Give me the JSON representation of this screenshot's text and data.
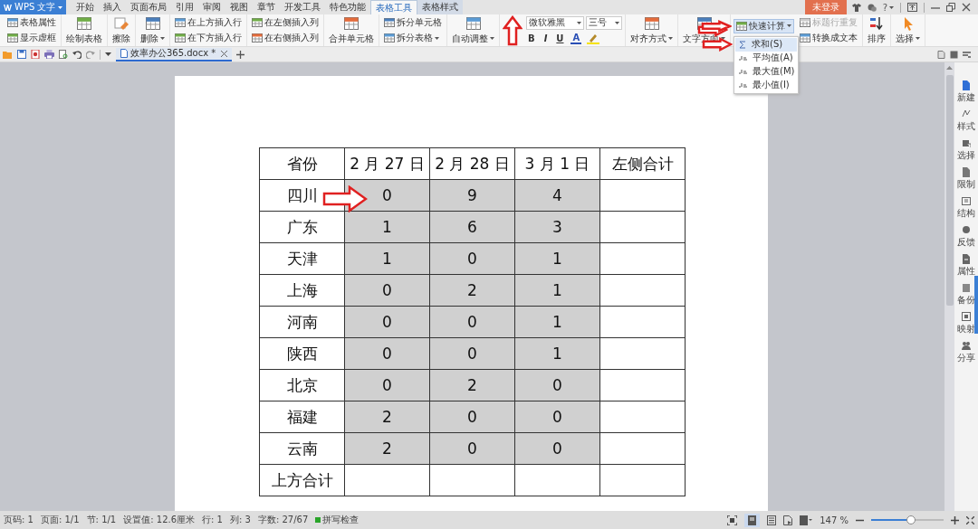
{
  "app_button": "WPS 文字",
  "menu_tabs": [
    {
      "label": "开始",
      "selected": false,
      "contextual": false
    },
    {
      "label": "插入",
      "selected": false,
      "contextual": false
    },
    {
      "label": "页面布局",
      "selected": false,
      "contextual": false
    },
    {
      "label": "引用",
      "selected": false,
      "contextual": false
    },
    {
      "label": "审阅",
      "selected": false,
      "contextual": false
    },
    {
      "label": "视图",
      "selected": false,
      "contextual": false
    },
    {
      "label": "章节",
      "selected": false,
      "contextual": false
    },
    {
      "label": "开发工具",
      "selected": false,
      "contextual": false
    },
    {
      "label": "特色功能",
      "selected": false,
      "contextual": false
    },
    {
      "label": "表格工具",
      "selected": true,
      "contextual": true
    },
    {
      "label": "表格样式",
      "selected": false,
      "contextual": true
    }
  ],
  "login_button": "未登录",
  "help_button": "?",
  "ribbon": [
    {
      "kind": "stack",
      "items": [
        {
          "label": "表格属性",
          "dropdown": false,
          "disabled": false
        },
        {
          "label": "显示虚框",
          "dropdown": false,
          "disabled": false
        }
      ]
    },
    {
      "kind": "large",
      "label": "绘制表格",
      "dropdown": false
    },
    {
      "kind": "large",
      "label": "擦除",
      "dropdown": false
    },
    {
      "kind": "large",
      "label": "删除",
      "dropdown": true
    },
    {
      "kind": "stack",
      "items": [
        {
          "label": "在上方插入行",
          "dropdown": false,
          "disabled": false
        },
        {
          "label": "在下方插入行",
          "dropdown": false,
          "disabled": false
        }
      ]
    },
    {
      "kind": "stack",
      "items": [
        {
          "label": "在左侧插入列",
          "dropdown": false,
          "disabled": false
        },
        {
          "label": "在右侧插入列",
          "dropdown": false,
          "disabled": false
        }
      ]
    },
    {
      "kind": "large",
      "label": "合并单元格",
      "dropdown": false
    },
    {
      "kind": "stack",
      "items": [
        {
          "label": "拆分单元格",
          "dropdown": false,
          "disabled": false
        },
        {
          "label": "拆分表格",
          "dropdown": true,
          "disabled": false
        }
      ]
    },
    {
      "kind": "large",
      "label": "自动调整",
      "dropdown": true
    },
    {
      "kind": "font",
      "font_name": "微软雅黑",
      "font_size": "三号",
      "buttons": [
        "B",
        "I",
        "U",
        "A"
      ]
    },
    {
      "kind": "large",
      "label": "对齐方式",
      "dropdown": true
    },
    {
      "kind": "large",
      "label": "文字方向",
      "dropdown": true
    },
    {
      "kind": "calc",
      "button": {
        "label": "快速计算",
        "dropdown": true,
        "expanded": true
      },
      "menu": [
        {
          "label": "求和(S)",
          "selected": true
        },
        {
          "label": "平均值(A)",
          "selected": false
        },
        {
          "label": "最大值(M)",
          "selected": false
        },
        {
          "label": "最小值(I)",
          "selected": false
        }
      ],
      "items": [
        {
          "label": "标题行重复",
          "dropdown": false,
          "disabled": true
        },
        {
          "label": "转换成文本",
          "dropdown": false,
          "disabled": false
        }
      ]
    },
    {
      "kind": "large",
      "label": "排序",
      "dropdown": false
    },
    {
      "kind": "large",
      "label": "选择",
      "dropdown": true
    }
  ],
  "document_tab": {
    "title": "效率办公365.docx *",
    "selected": true
  },
  "table": {
    "rows": [
      {
        "cells": [
          {
            "text": "省份",
            "selected": false
          },
          {
            "text": "2 月 27 日",
            "selected": false
          },
          {
            "text": "2 月 28 日",
            "selected": false
          },
          {
            "text": "3 月 1 日",
            "selected": false
          },
          {
            "text": "左侧合计",
            "selected": false
          }
        ]
      },
      {
        "cells": [
          {
            "text": "四川",
            "selected": false
          },
          {
            "text": "0",
            "selected": true
          },
          {
            "text": "9",
            "selected": true
          },
          {
            "text": "4",
            "selected": true
          },
          {
            "selected": false
          }
        ]
      },
      {
        "cells": [
          {
            "text": "广东",
            "selected": false
          },
          {
            "text": "1",
            "selected": true
          },
          {
            "text": "6",
            "selected": true
          },
          {
            "text": "3",
            "selected": true
          },
          {
            "selected": false
          }
        ]
      },
      {
        "cells": [
          {
            "text": "天津",
            "selected": false
          },
          {
            "text": "1",
            "selected": true
          },
          {
            "text": "0",
            "selected": true
          },
          {
            "text": "1",
            "selected": true
          },
          {
            "selected": false
          }
        ]
      },
      {
        "cells": [
          {
            "text": "上海",
            "selected": false
          },
          {
            "text": "0",
            "selected": true
          },
          {
            "text": "2",
            "selected": true
          },
          {
            "text": "1",
            "selected": true
          },
          {
            "selected": false
          }
        ]
      },
      {
        "cells": [
          {
            "text": "河南",
            "selected": false
          },
          {
            "text": "0",
            "selected": true
          },
          {
            "text": "0",
            "selected": true
          },
          {
            "text": "1",
            "selected": true
          },
          {
            "selected": false
          }
        ]
      },
      {
        "cells": [
          {
            "text": "陕西",
            "selected": false
          },
          {
            "text": "0",
            "selected": true
          },
          {
            "text": "0",
            "selected": true
          },
          {
            "text": "1",
            "selected": true
          },
          {
            "selected": false
          }
        ]
      },
      {
        "cells": [
          {
            "text": "北京",
            "selected": false
          },
          {
            "text": "0",
            "selected": true
          },
          {
            "text": "2",
            "selected": true
          },
          {
            "text": "0",
            "selected": true
          },
          {
            "selected": false
          }
        ]
      },
      {
        "cells": [
          {
            "text": "福建",
            "selected": false
          },
          {
            "text": "2",
            "selected": true
          },
          {
            "text": "0",
            "selected": true
          },
          {
            "text": "0",
            "selected": true
          },
          {
            "selected": false
          }
        ]
      },
      {
        "cells": [
          {
            "text": "云南",
            "selected": false
          },
          {
            "text": "2",
            "selected": true
          },
          {
            "text": "0",
            "selected": true
          },
          {
            "text": "0",
            "selected": true
          },
          {
            "selected": false
          }
        ]
      },
      {
        "cells": [
          {
            "text": "上方合计",
            "selected": false
          },
          {
            "selected": false
          },
          {
            "selected": false
          },
          {
            "selected": false
          },
          {
            "selected": false
          }
        ]
      }
    ]
  },
  "sidebar": [
    {
      "label": "新建"
    },
    {
      "label": "样式"
    },
    {
      "label": "选择"
    },
    {
      "label": "限制"
    },
    {
      "label": "结构"
    },
    {
      "label": "反馈"
    },
    {
      "label": "属性"
    },
    {
      "label": "备份"
    },
    {
      "label": "映射"
    },
    {
      "label": "分享"
    }
  ],
  "status": [
    "页码: 1",
    "页面: 1/1",
    "节: 1/1",
    "设置值: 12.6厘米",
    "行: 1",
    "列: 3",
    "字数: 27/67"
  ],
  "spell_check": {
    "label": "拼写检查",
    "on": true
  },
  "zoom": {
    "reading": "147 %",
    "level": 0.55
  }
}
